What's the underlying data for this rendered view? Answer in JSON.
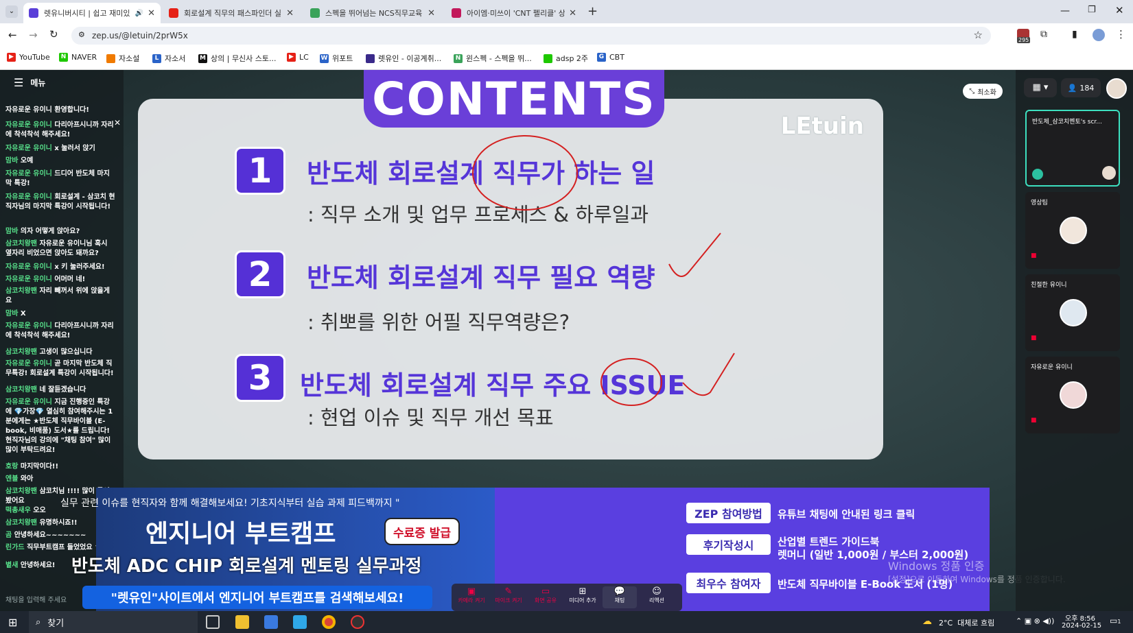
{
  "browser": {
    "tabs": [
      {
        "title": "렛유니버시티 | 쉽고 재미있",
        "active": true,
        "color": "#5a3fd8"
      },
      {
        "title": "회로설계 직무의 패스파인더 실",
        "active": false,
        "color": "#e62117"
      },
      {
        "title": "스펙을 뛰어넘는 NCS직무교육",
        "active": false,
        "color": "#3aa35a"
      },
      {
        "title": "아이엠·미쓰이 'CNT 펠리클' 상",
        "active": false,
        "color": "#c2185b"
      }
    ],
    "new_tab": "+",
    "url": "zep.us/@letuin/2prW5x",
    "bookmarks": [
      "YouTube",
      "NAVER",
      "자소설",
      "자소서",
      "상의 | 무신사 스토...",
      "LC",
      "위포트",
      "렛유인 - 이공계취...",
      "윈스펙 - 스펙을 뛰...",
      "adsp 2주",
      "CBT"
    ],
    "ext_badge": "295"
  },
  "zep": {
    "menu_label": "메뉴",
    "minimize_label": "최소화",
    "user_count": "184",
    "chat_input_placeholder": "채팅을 입력해 주세요",
    "chat": [
      {
        "name": "",
        "text": "자유로운 유이니 환영합니다!"
      },
      {
        "name": "자유로운 유이니",
        "text": "다리아프시니까 자리에 착석착석 해주세요!"
      },
      {
        "name": "자유로운 유이니",
        "text": "x 눌러서 앉기"
      },
      {
        "name": "맘바",
        "text": "오예"
      },
      {
        "name": "자유로운 유이니",
        "text": "드디어 반도체 마지막 특강!"
      },
      {
        "name": "자유로운 유이니",
        "text": "회로설계 - 삼코치 현직자님의 마지막 특강이 시작됩니다!"
      },
      {
        "name": "맘바",
        "text": "의자 어떻게 앉아요?"
      },
      {
        "name": "삼코치왕팬",
        "text": "자유로운 유이니님 혹시 옆자리 비었으면 앉아도 돼까요?"
      },
      {
        "name": "자유로운 유이니",
        "text": "x 키 눌러주세요!"
      },
      {
        "name": "자유로운 유이니",
        "text": "어머머 네!"
      },
      {
        "name": "삼코치왕팬",
        "text": "자리 빼꺼서 위에 앉을게요"
      },
      {
        "name": "맘바",
        "text": "X"
      },
      {
        "name": "자유로운 유이니",
        "text": "다리아프시니까 자리에 착석착석 해주세요!"
      },
      {
        "name": "삼코치왕팬",
        "text": "고생이 많으십니다"
      },
      {
        "name": "자유로운 유이니",
        "text": "곧 마지막 반도체 직무특강! 회로설계 특강이 시작됩니다!"
      },
      {
        "name": "삼코치왕팬",
        "text": "네 잘듣겠습니다"
      },
      {
        "name": "자유로운 유이니",
        "text": "지금 진행중인 특강에 💎가장💎 열심히 참여해주시는 1분에게는 ★반도체 직무바이블 (E-book, 비매품) 도서★를 드립니다! 현직자님의 강의에 \"채팅 참여\" 많이 많이 부탁드려요!"
      },
      {
        "name": "호랑",
        "text": "마지막이다!!"
      },
      {
        "name": "엔블",
        "text": "와아"
      },
      {
        "name": "삼코치왕팬",
        "text": "삼코치님 !!!! 많이 들어봤어요"
      },
      {
        "name": "떡총새우",
        "text": "오오"
      },
      {
        "name": "삼코치왕팬",
        "text": "유명하시죠!!"
      },
      {
        "name": "곰",
        "text": "안녕하세요~~~~~~~"
      },
      {
        "name": "린가드",
        "text": "직무부트캠프 들었었요 ㅎ ㅎ"
      },
      {
        "name": "볕새",
        "text": "안녕하세요!"
      }
    ],
    "slide": {
      "title": "CONTENTS",
      "logo": "LEtuin",
      "items": [
        {
          "num": "1",
          "head": "반도체 회로설계 직무가 하는 일",
          "sub": ": 직무 소개 및 업무 프로세스 & 하루일과"
        },
        {
          "num": "2",
          "head": "반도체 회로설계 직무 필요 역량",
          "sub": ": 취뽀를 위한 어필 직무역량은?"
        },
        {
          "num": "3",
          "head": "반도체 회로설계 직무 주요 ISSUE",
          "sub": ": 현업 이슈 및 직무 개선 목표"
        }
      ]
    },
    "banner_left": {
      "tagline": "실무 관련 이슈를 현직자와 함께 해결해보세요! 기초지식부터 실습 과제 피드백까지 \"",
      "title": "엔지니어 부트캠프",
      "badge": "수료증 발급",
      "course": "반도체 ADC CHIP 회로설계 멘토링 실무과정",
      "search": "\"렛유인\"사이트에서 엔지니어 부트캠프를 검색해보세요!"
    },
    "banner_right": [
      {
        "pill": "ZEP 참여방법",
        "text": "유튜브 채팅에 안내된 링크 클릭"
      },
      {
        "pill": "후기작성시",
        "text": "산업별 트렌드 가이드북\n렛머니 (일반 1,000원 / 부스터 2,000원)"
      },
      {
        "pill": "최우수 참여자",
        "text": "반도체 직무바이블 E-Book 도서 (1명)"
      }
    ],
    "bottom_buttons": [
      "카메라 켜기",
      "마이크 켜기",
      "화면 공유",
      "미디어 추가",
      "채팅",
      "리액션"
    ],
    "participants": [
      {
        "name": "반도체_삼코치멘토's scr..."
      },
      {
        "name": "영상팀"
      },
      {
        "name": "친절한 유이니"
      },
      {
        "name": "자유로운 유이니"
      }
    ],
    "watermark_1": "Windows 정품 인증",
    "watermark_2": "[설정]으로 이동하여 Windows를 정품 인증합니다."
  },
  "taskbar": {
    "search": "찾기",
    "weather": "2°C  대체로 흐림",
    "time": "오후 8:56",
    "date": "2024-02-15",
    "notif": "1"
  },
  "colors": {
    "accent": "#5a3fe0",
    "chat_name": "#57e08a",
    "slide_num": "#5530d6"
  }
}
